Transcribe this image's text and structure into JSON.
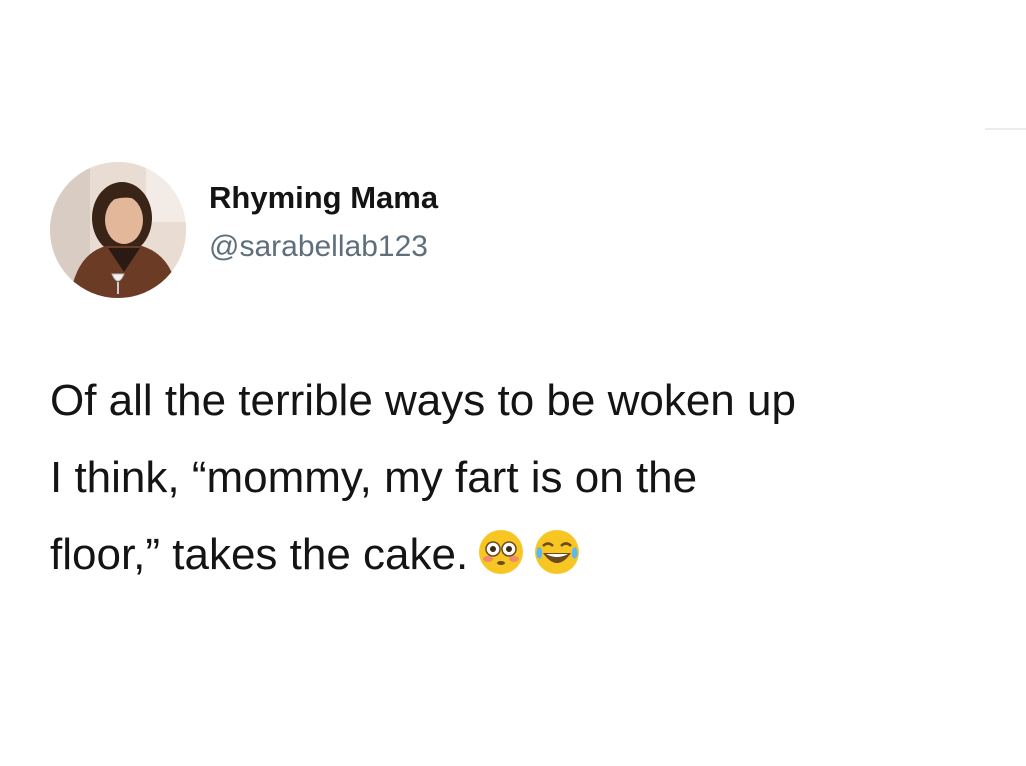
{
  "author": {
    "display_name": "Rhyming Mama",
    "handle": "@sarabellab123",
    "avatar_icon": "profile-photo-woman"
  },
  "tweet": {
    "lines": [
      "Of all the terrible ways to be woken up",
      "I think, “mommy, my fart is on the",
      "floor,” takes the cake."
    ],
    "emojis": [
      "flushed-face-icon",
      "tears-of-joy-face-icon"
    ]
  },
  "colors": {
    "background": "#ffffff",
    "text": "#141414",
    "handle": "#5f6e7b",
    "emoji_yellow": "#f8c623"
  }
}
